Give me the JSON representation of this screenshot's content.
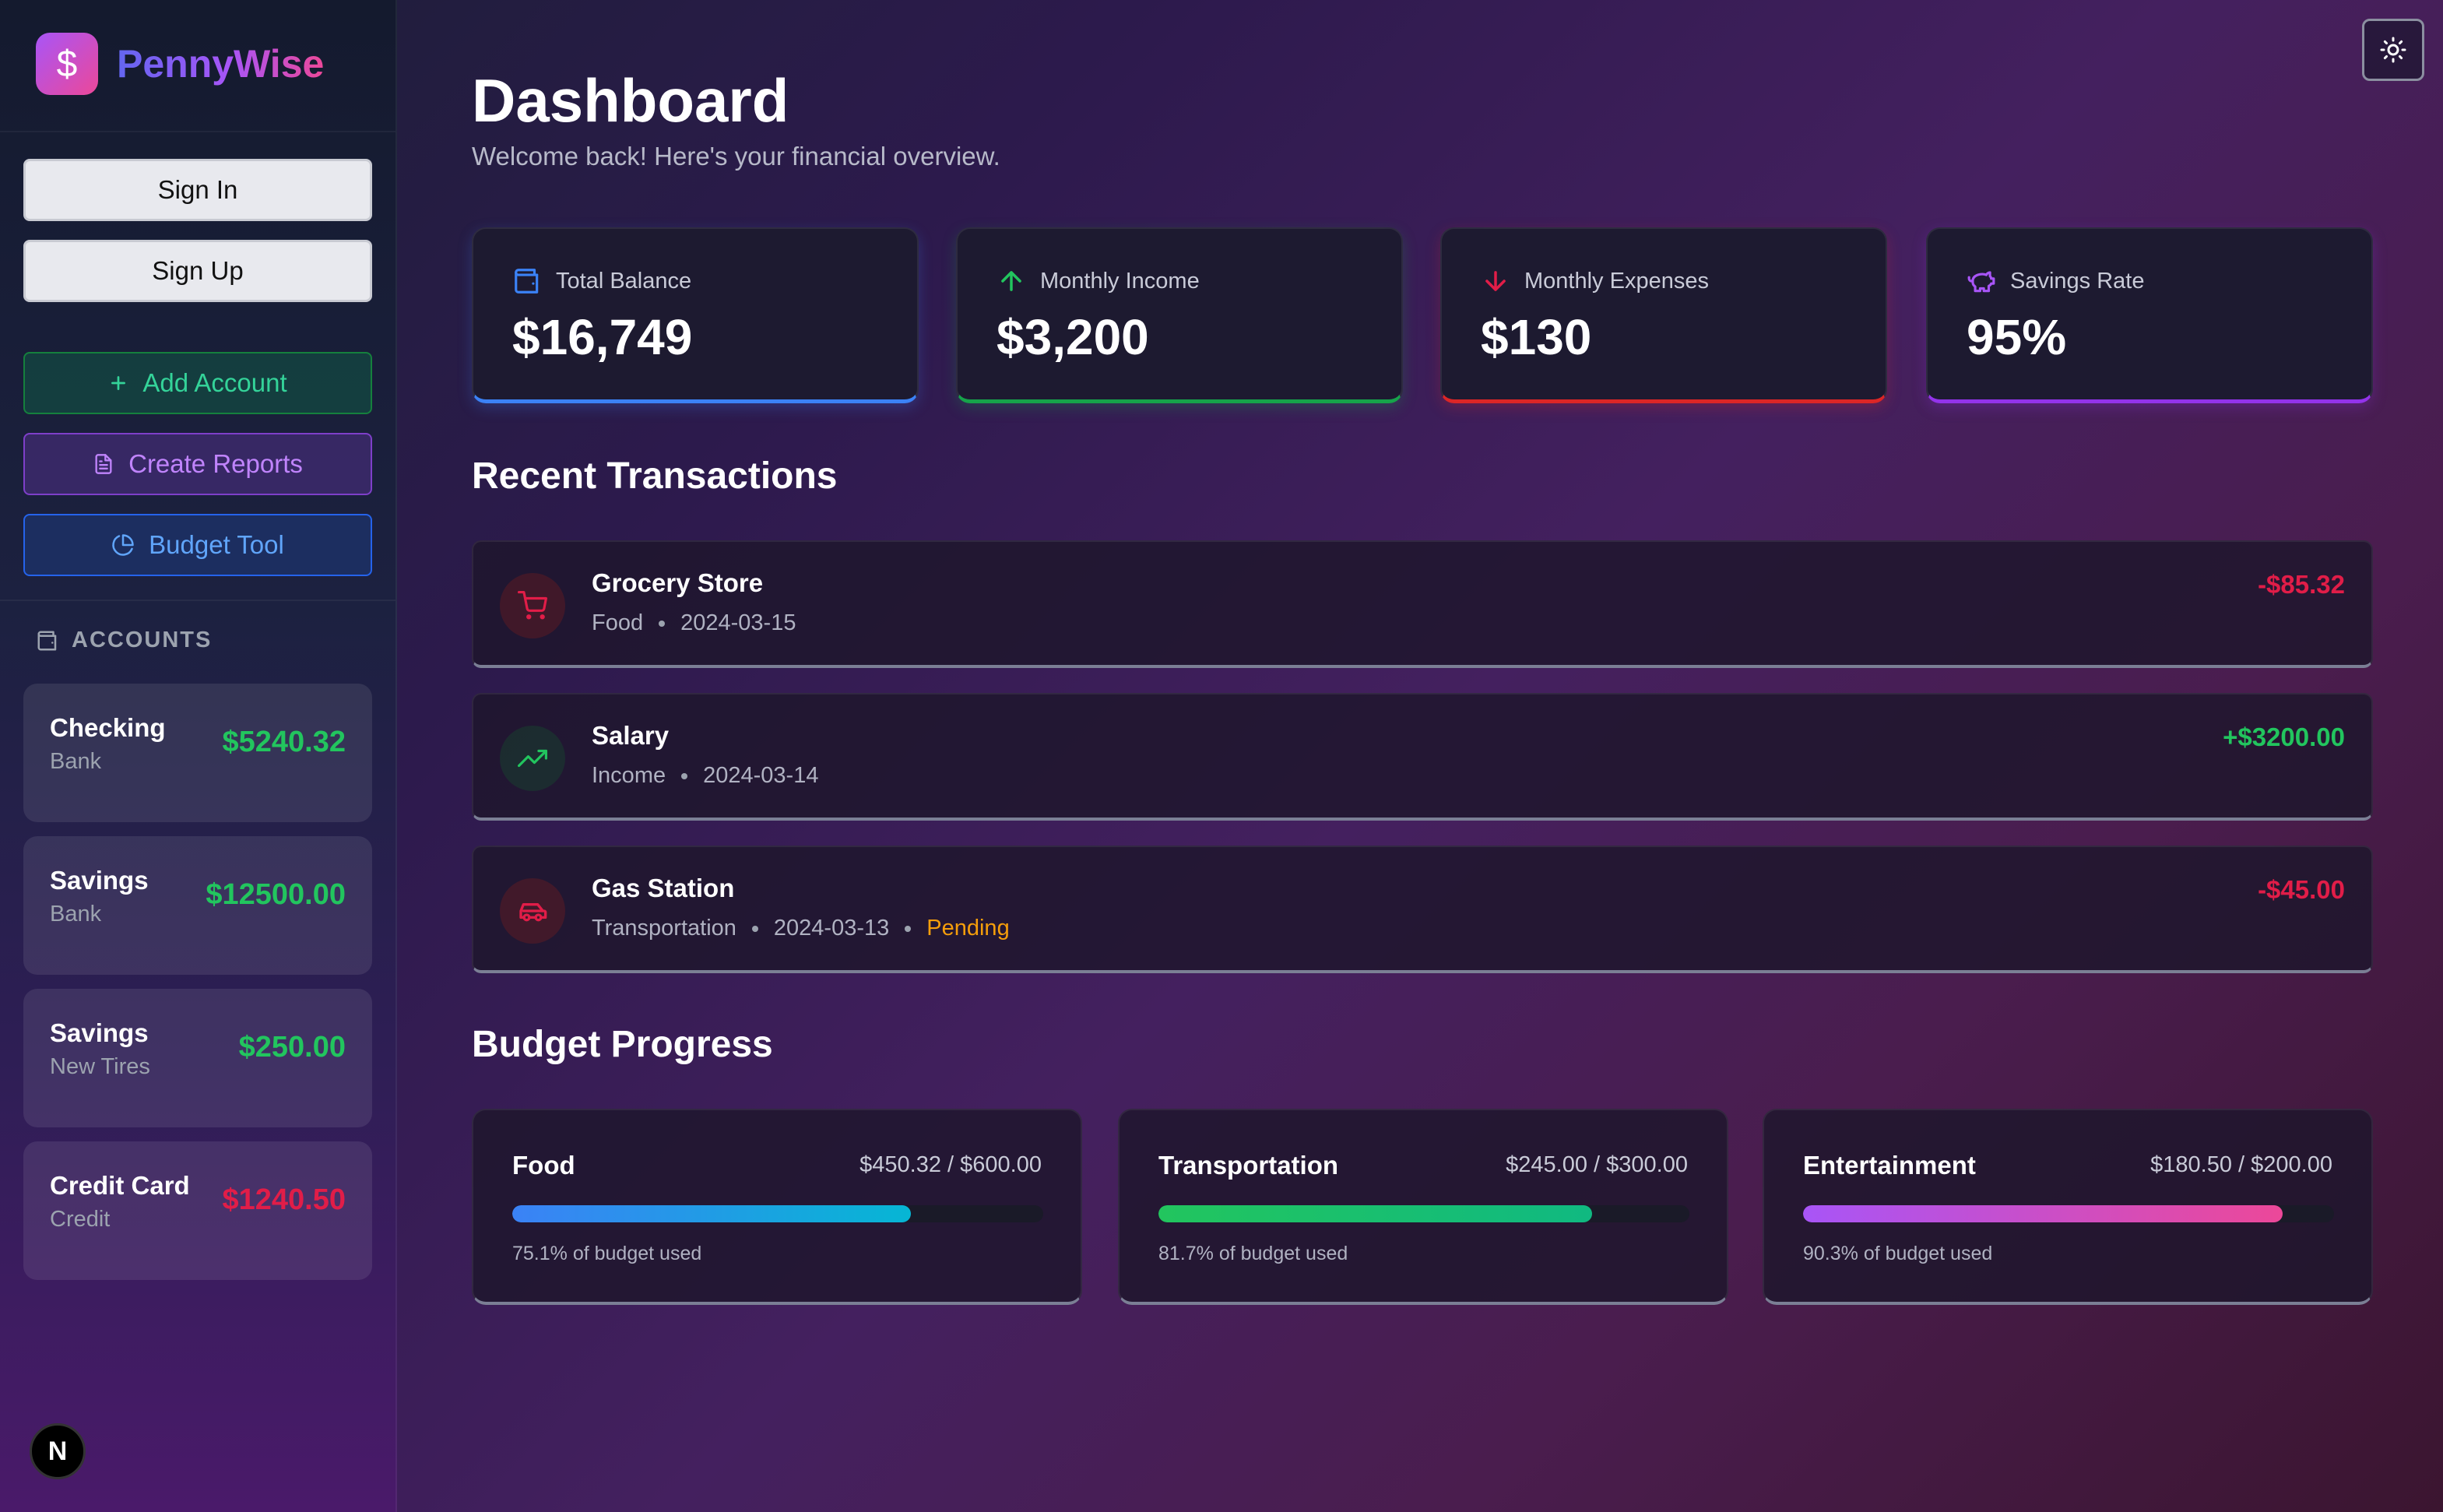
{
  "brand": {
    "logo_glyph": "$",
    "name": "PennyWise"
  },
  "auth": {
    "sign_in": "Sign In",
    "sign_up": "Sign Up"
  },
  "actions": {
    "add_account": "Add Account",
    "create_reports": "Create Reports",
    "budget_tool": "Budget Tool"
  },
  "accounts": {
    "heading": "ACCOUNTS",
    "items": [
      {
        "name": "Checking",
        "type": "Bank",
        "balance": "$5240.32",
        "color": "#22c55e"
      },
      {
        "name": "Savings",
        "type": "Bank",
        "balance": "$12500.00",
        "color": "#22c55e"
      },
      {
        "name": "Savings",
        "type": "New Tires",
        "balance": "$250.00",
        "color": "#22c55e"
      },
      {
        "name": "Credit Card",
        "type": "Credit",
        "balance": "$1240.50",
        "color": "#e11d48"
      }
    ]
  },
  "header": {
    "title": "Dashboard",
    "subtitle": "Welcome back! Here's your financial overview."
  },
  "stats": [
    {
      "label": "Total Balance",
      "value": "$16,749",
      "icon": "wallet-icon",
      "color": "#3b82f6"
    },
    {
      "label": "Monthly Income",
      "value": "$3,200",
      "icon": "arrow-up-icon",
      "color": "#22c55e"
    },
    {
      "label": "Monthly Expenses",
      "value": "$130",
      "icon": "arrow-down-icon",
      "color": "#e11d48"
    },
    {
      "label": "Savings Rate",
      "value": "95%",
      "icon": "piggy-bank-icon",
      "color": "#a855f7"
    }
  ],
  "transactions": {
    "title": "Recent Transactions",
    "items": [
      {
        "name": "Grocery Store",
        "category": "Food",
        "date": "2024-03-15",
        "amount": "-$85.32",
        "icon": "shopping-cart-icon",
        "status": ""
      },
      {
        "name": "Salary",
        "category": "Income",
        "date": "2024-03-14",
        "amount": "+$3200.00",
        "icon": "trending-up-icon",
        "status": ""
      },
      {
        "name": "Gas Station",
        "category": "Transportation",
        "date": "2024-03-13",
        "amount": "-$45.00",
        "icon": "car-icon",
        "status": "Pending"
      }
    ]
  },
  "budgets": {
    "title": "Budget Progress",
    "items": [
      {
        "name": "Food",
        "amount": "$450.32 / $600.00",
        "used": 0.751,
        "note": "75.1% of budget used",
        "gradient": [
          "#3b82f6",
          "#06b6d4"
        ]
      },
      {
        "name": "Transportation",
        "amount": "$245.00 / $300.00",
        "used": 0.817,
        "note": "81.7% of budget used",
        "gradient": [
          "#22c55e",
          "#10b981"
        ]
      },
      {
        "name": "Entertainment",
        "amount": "$180.50 / $200.00",
        "used": 0.903,
        "note": "90.3% of budget used",
        "gradient": [
          "#a855f7",
          "#ec4899"
        ]
      }
    ]
  },
  "framework_badge": "N",
  "theme_toggle_icon": "sun-icon"
}
